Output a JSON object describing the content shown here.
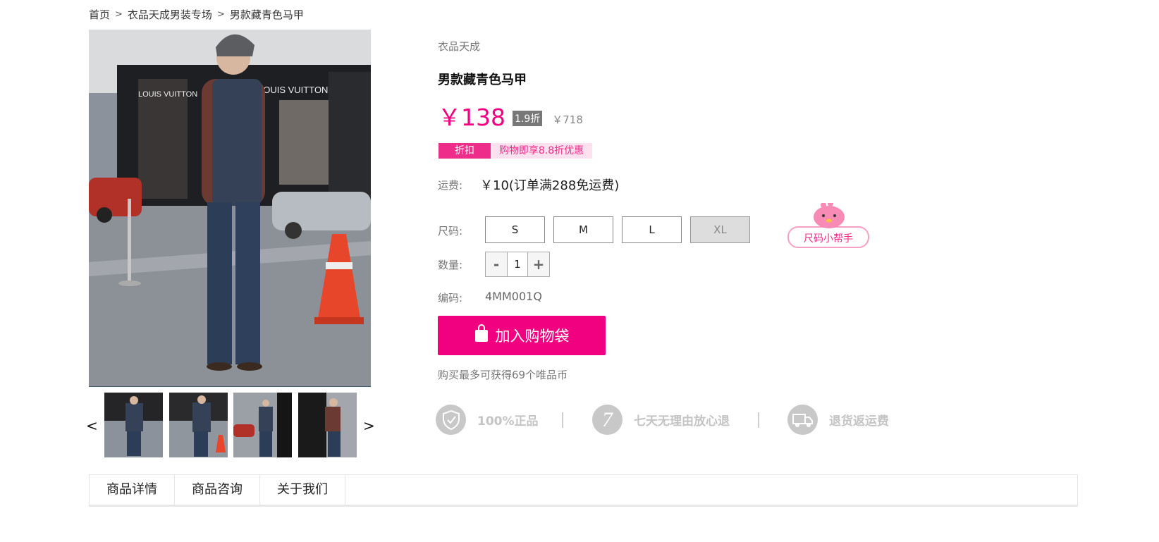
{
  "breadcrumb": {
    "items": [
      "首页",
      "衣品天成男装专场",
      "男款藏青色马甲"
    ],
    "separator": ">"
  },
  "gallery": {
    "prev_label": "<",
    "next_label": ">",
    "thumbnail_count": 4
  },
  "product": {
    "brand": "衣品天成",
    "title": "男款藏青色马甲",
    "price": "￥138",
    "discount": "1.9折",
    "original_price": "￥718",
    "promo_tag": "折扣",
    "promo_text": "购物即享8.8折优惠",
    "shipping_label": "运费:",
    "shipping_value": "￥10(订单满288免运费)",
    "size_label": "尺码:",
    "sizes": [
      "S",
      "M",
      "L",
      "XL"
    ],
    "size_helper": "尺码小帮手",
    "quantity_label": "数量:",
    "quantity_minus": "-",
    "quantity_plus": "+",
    "quantity_value": "1",
    "code_label": "编码:",
    "code_value": "4MM001Q",
    "add_to_bag": "加入购物袋",
    "coin_text": "购买最多可获得69个唯品币"
  },
  "guarantees": [
    {
      "icon": "shield-check-icon",
      "text": "100%正品"
    },
    {
      "icon": "seven-days-icon",
      "text": "七天无理由放心退",
      "glyph": "7"
    },
    {
      "icon": "truck-icon",
      "text": "退货返运费"
    }
  ],
  "tabs": [
    "商品详情",
    "商品咨询",
    "关于我们"
  ],
  "colors": {
    "accent": "#f10180",
    "promo_pink": "#ee2d8b",
    "promo_bg": "#fde1ee",
    "muted": "#777777"
  }
}
